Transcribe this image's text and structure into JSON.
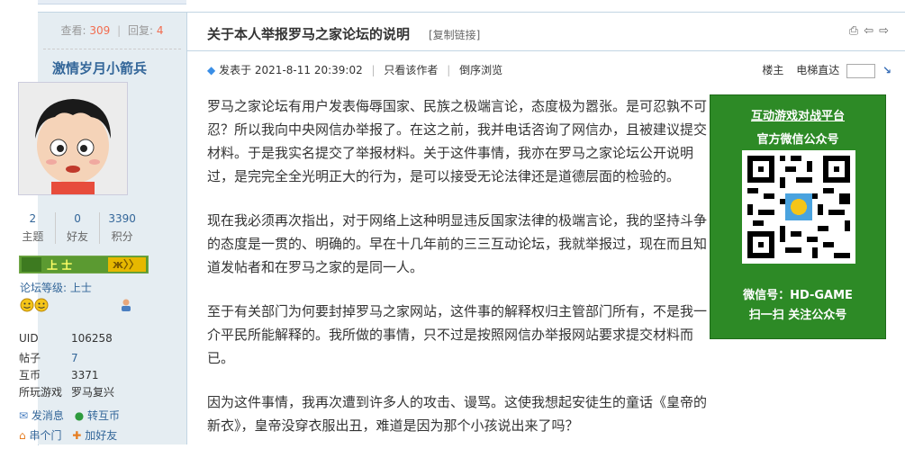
{
  "sidebar": {
    "views_label": "查看:",
    "views": "309",
    "replies_label": "回复:",
    "replies": "4",
    "username": "激情岁月小箭兵",
    "stats": [
      {
        "value": "2",
        "label": "主题"
      },
      {
        "value": "0",
        "label": "好友"
      },
      {
        "value": "3390",
        "label": "积分"
      }
    ],
    "rank_text": "上 士",
    "level_label": "论坛等级:",
    "level_value": "上士",
    "fields": [
      {
        "k": "UID",
        "v": "106258"
      },
      {
        "k": "帖子",
        "v": "7"
      },
      {
        "k": "互币",
        "v": "3371"
      },
      {
        "k": "所玩游戏",
        "v": "罗马复兴"
      }
    ],
    "actions_row1": [
      "发消息",
      "转互币"
    ],
    "actions_row2": [
      "串个门",
      "加好友"
    ]
  },
  "post": {
    "title": "关于本人举报罗马之家论坛的说明",
    "copy_link": "[复制链接]",
    "posted_label": "发表于",
    "posted_time": "2021-8-11 20:39:02",
    "only_author": "只看该作者",
    "reverse_view": "倒序浏览",
    "floor": "楼主",
    "elevator": "电梯直达",
    "paragraphs": [
      "罗马之家论坛有用户发表侮辱国家、民族之极端言论，态度极为嚣张。是可忍孰不可忍？所以我向中央网信办举报了。在这之前，我并电话咨询了网信办，且被建议提交材料。于是我实名提交了举报材料。关于这件事情，我亦在罗马之家论坛公开说明过，是完完全全光明正大的行为，是可以接受无论法律还是道德层面的检验的。",
      "现在我必须再次指出，对于网络上这种明显违反国家法律的极端言论，我的坚持斗争的态度是一贯的、明确的。早在十几年前的三三互动论坛，我就举报过，现在而且知道发帖者和在罗马之家的是同一人。",
      "至于有关部门为何要封掉罗马之家网站，这件事的解释权归主管部门所有，不是我一介平民所能解释的。我所做的事情，只不过是按照网信办举报网站要求提交材料而已。",
      "因为这件事情，我再次遭到许多人的攻击、谩骂。这使我想起安徒生的童话《皇帝的新衣》，皇帝没穿衣服出丑，难道是因为那个小孩说出来了吗？"
    ]
  },
  "ad": {
    "line1": "互动游戏对战平台",
    "line2": "官方微信公众号",
    "line3": "微信号：HD-GAME",
    "line4": "扫一扫 关注公众号",
    "bg_color": "#2d8a26"
  },
  "icons": [
    "print-icon",
    "prev-icon",
    "next-icon",
    "jump-icon",
    "post-time-icon",
    "message-icon",
    "transfer-icon",
    "visit-icon",
    "add-friend-icon",
    "medal-icon",
    "person-icon"
  ]
}
